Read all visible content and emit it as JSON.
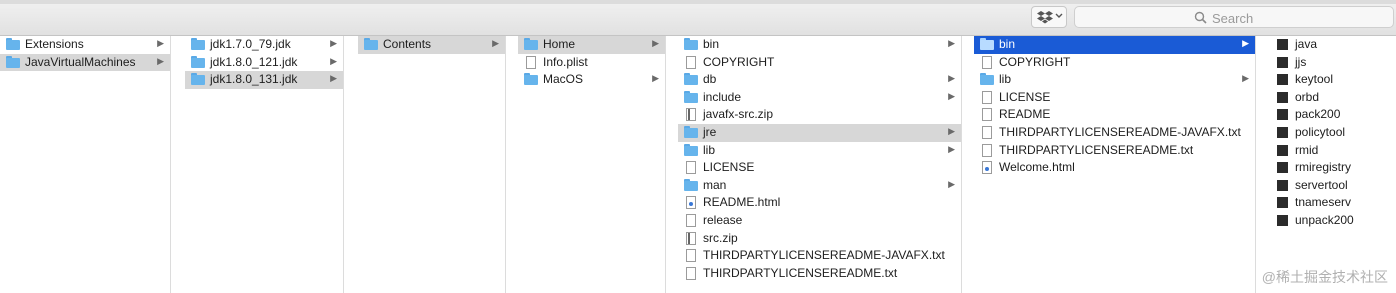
{
  "toolbar": {
    "search_placeholder": "Search"
  },
  "columns": [
    {
      "items": [
        {
          "label": "Extensions",
          "icon": "folder-icon",
          "arrow": true,
          "state": ""
        },
        {
          "label": "JavaVirtualMachines",
          "icon": "folder-icon",
          "arrow": true,
          "state": "gray"
        }
      ]
    },
    {
      "items": [
        {
          "label": "jdk1.7.0_79.jdk",
          "icon": "folder-icon",
          "arrow": true,
          "state": ""
        },
        {
          "label": "jdk1.8.0_121.jdk",
          "icon": "folder-icon",
          "arrow": true,
          "state": ""
        },
        {
          "label": "jdk1.8.0_131.jdk",
          "icon": "folder-icon",
          "arrow": true,
          "state": "gray"
        }
      ]
    },
    {
      "items": [
        {
          "label": "Contents",
          "icon": "folder-icon",
          "arrow": true,
          "state": "gray"
        }
      ]
    },
    {
      "items": [
        {
          "label": "Home",
          "icon": "folder-icon",
          "arrow": true,
          "state": "gray"
        },
        {
          "label": "Info.plist",
          "icon": "document-icon",
          "arrow": false,
          "state": ""
        },
        {
          "label": "MacOS",
          "icon": "folder-icon",
          "arrow": true,
          "state": ""
        }
      ]
    },
    {
      "items": [
        {
          "label": "bin",
          "icon": "folder-icon",
          "arrow": true,
          "state": ""
        },
        {
          "label": "COPYRIGHT",
          "icon": "document-icon",
          "arrow": false,
          "state": ""
        },
        {
          "label": "db",
          "icon": "folder-icon",
          "arrow": true,
          "state": ""
        },
        {
          "label": "include",
          "icon": "folder-icon",
          "arrow": true,
          "state": ""
        },
        {
          "label": "javafx-src.zip",
          "icon": "zip-icon",
          "arrow": false,
          "state": ""
        },
        {
          "label": "jre",
          "icon": "folder-icon",
          "arrow": true,
          "state": "gray"
        },
        {
          "label": "lib",
          "icon": "folder-icon",
          "arrow": true,
          "state": ""
        },
        {
          "label": "LICENSE",
          "icon": "document-icon",
          "arrow": false,
          "state": ""
        },
        {
          "label": "man",
          "icon": "folder-icon",
          "arrow": true,
          "state": ""
        },
        {
          "label": "README.html",
          "icon": "html-icon",
          "arrow": false,
          "state": ""
        },
        {
          "label": "release",
          "icon": "document-icon",
          "arrow": false,
          "state": ""
        },
        {
          "label": "src.zip",
          "icon": "zip-icon",
          "arrow": false,
          "state": ""
        },
        {
          "label": "THIRDPARTYLICENSEREADME-JAVAFX.txt",
          "icon": "document-icon",
          "arrow": false,
          "state": ""
        },
        {
          "label": "THIRDPARTYLICENSEREADME.txt",
          "icon": "document-icon",
          "arrow": false,
          "state": ""
        }
      ]
    },
    {
      "items": [
        {
          "label": "bin",
          "icon": "folder-icon",
          "arrow": true,
          "state": "blue"
        },
        {
          "label": "COPYRIGHT",
          "icon": "document-icon",
          "arrow": false,
          "state": ""
        },
        {
          "label": "lib",
          "icon": "folder-icon",
          "arrow": true,
          "state": ""
        },
        {
          "label": "LICENSE",
          "icon": "document-icon",
          "arrow": false,
          "state": ""
        },
        {
          "label": "README",
          "icon": "document-icon",
          "arrow": false,
          "state": ""
        },
        {
          "label": "THIRDPARTYLICENSEREADME-JAVAFX.txt",
          "icon": "document-icon",
          "arrow": false,
          "state": ""
        },
        {
          "label": "THIRDPARTYLICENSEREADME.txt",
          "icon": "document-icon",
          "arrow": false,
          "state": ""
        },
        {
          "label": "Welcome.html",
          "icon": "html-icon",
          "arrow": false,
          "state": ""
        }
      ]
    },
    {
      "items": [
        {
          "label": "java",
          "icon": "executable-icon",
          "arrow": false,
          "state": ""
        },
        {
          "label": "jjs",
          "icon": "executable-icon",
          "arrow": false,
          "state": ""
        },
        {
          "label": "keytool",
          "icon": "executable-icon",
          "arrow": false,
          "state": ""
        },
        {
          "label": "orbd",
          "icon": "executable-icon",
          "arrow": false,
          "state": ""
        },
        {
          "label": "pack200",
          "icon": "executable-icon",
          "arrow": false,
          "state": ""
        },
        {
          "label": "policytool",
          "icon": "executable-icon",
          "arrow": false,
          "state": ""
        },
        {
          "label": "rmid",
          "icon": "executable-icon",
          "arrow": false,
          "state": ""
        },
        {
          "label": "rmiregistry",
          "icon": "executable-icon",
          "arrow": false,
          "state": ""
        },
        {
          "label": "servertool",
          "icon": "executable-icon",
          "arrow": false,
          "state": ""
        },
        {
          "label": "tnameserv",
          "icon": "executable-icon",
          "arrow": false,
          "state": ""
        },
        {
          "label": "unpack200",
          "icon": "executable-icon",
          "arrow": false,
          "state": ""
        }
      ]
    }
  ],
  "watermark": "@稀土掘金技术社区"
}
